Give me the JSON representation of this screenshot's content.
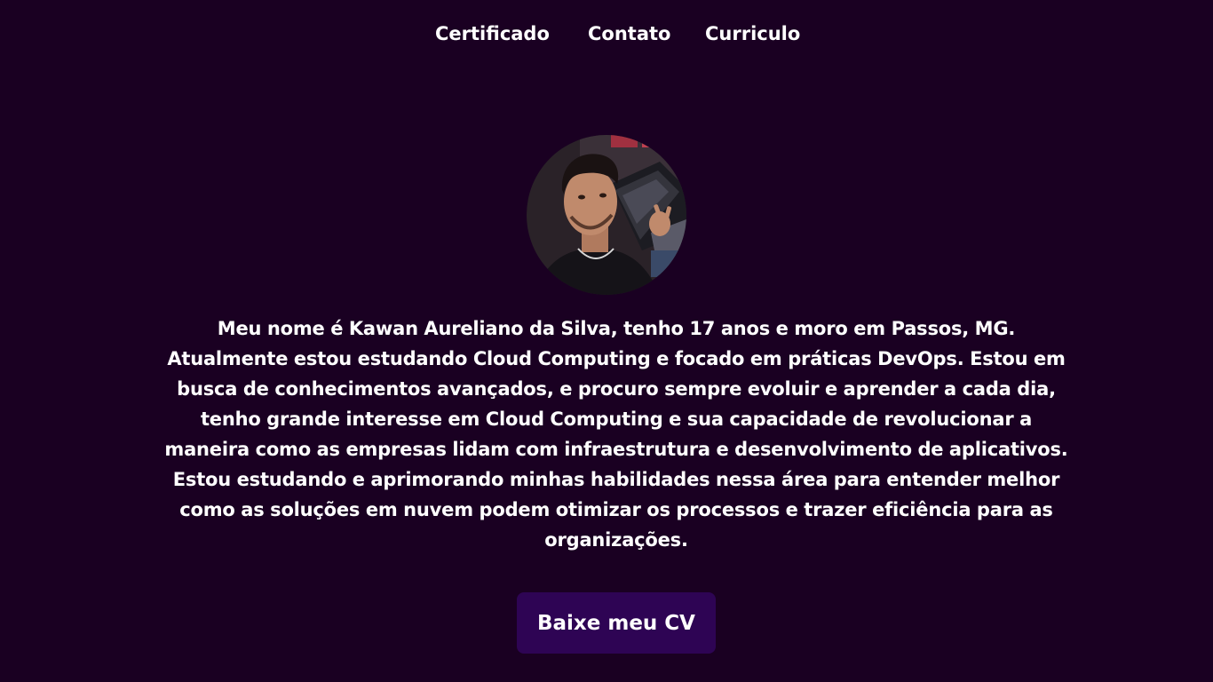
{
  "nav": {
    "items": [
      {
        "label": "Certificado"
      },
      {
        "label": "Contato"
      },
      {
        "label": "Curriculo"
      }
    ]
  },
  "profile": {
    "avatar_icon": "profile-photo",
    "bio": "Meu nome é Kawan Aureliano da Silva, tenho 17 anos e moro em Passos, MG. Atualmente estou estudando Cloud Computing e focado em práticas DevOps. Estou em busca de conhecimentos avançados, e procuro sempre evoluir e aprender a cada dia, tenho grande interesse em Cloud Computing e sua capacidade de revolucionar a maneira como as empresas lidam com infraestrutura e desenvolvimento de aplicativos. Estou estudando e aprimorando minhas habilidades nessa área para entender melhor como as soluções em nuvem podem otimizar os processos e trazer eficiência para as organizações."
  },
  "cta": {
    "label": "Baixe meu CV"
  },
  "colors": {
    "background": "#1a0022",
    "button": "#2e0454",
    "text": "#ffffff"
  }
}
